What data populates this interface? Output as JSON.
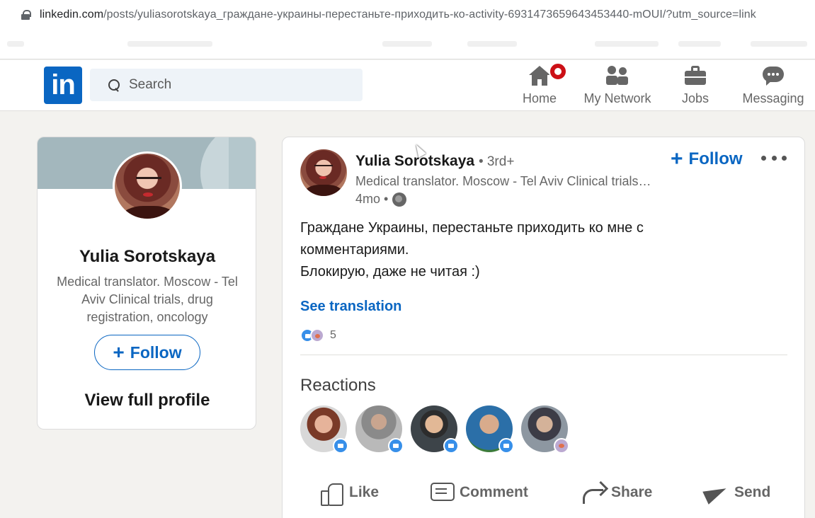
{
  "browser": {
    "url_host": "linkedin.com",
    "url_rest": "/posts/yuliasorotskaya_граждане-украины-перестаньте-приходить-ко-activity-6931473659643453440-mOUI/?utm_source=link"
  },
  "nav": {
    "logo": "in",
    "search_placeholder": "Search",
    "items": [
      {
        "label": "Home"
      },
      {
        "label": "My Network"
      },
      {
        "label": "Jobs"
      },
      {
        "label": "Messaging"
      }
    ]
  },
  "profile_card": {
    "name": "Yulia Sorotskaya",
    "headline": "Medical translator. Moscow - Tel Aviv Clinical trials, drug registration, oncology",
    "follow_label": "Follow",
    "view_profile_label": "View full profile"
  },
  "post": {
    "author": "Yulia Sorotskaya",
    "degree": "• 3rd+",
    "headline": "Medical translator. Moscow - Tel Aviv Clinical trials, drug registration, oncology",
    "time": "4mo •",
    "follow_label": "Follow",
    "text_line1": "Граждане Украины, перестаньте приходить ко мне с",
    "text_line2": "комментариями.",
    "text_line3": "Блокирую, даже не читая :)",
    "see_translation": "See translation",
    "reaction_count": "5",
    "reactions_title": "Reactions",
    "actions": {
      "like": "Like",
      "comment": "Comment",
      "share": "Share",
      "send": "Send"
    }
  }
}
